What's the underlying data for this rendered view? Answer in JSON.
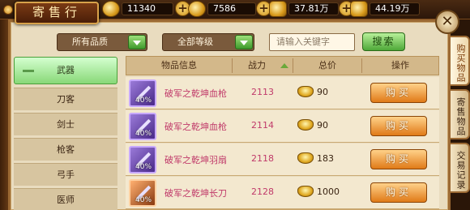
{
  "window": {
    "title": "寄售行"
  },
  "currencies": [
    {
      "icon": "gold-coin-icon",
      "value": "11340"
    },
    {
      "icon": "silver-coin-icon",
      "value": "7586"
    },
    {
      "icon": "coin-stack-icon",
      "value": "37.81万"
    },
    {
      "icon": "coin-stack-icon",
      "value": "44.19万"
    }
  ],
  "filters": {
    "quality": "所有品质",
    "level": "全部等级",
    "keyword_placeholder": "请输入关键字",
    "search_label": "搜索"
  },
  "categories": [
    {
      "label": "武器",
      "active": true
    },
    {
      "label": "刀客",
      "active": false
    },
    {
      "label": "剑士",
      "active": false
    },
    {
      "label": "枪客",
      "active": false
    },
    {
      "label": "弓手",
      "active": false
    },
    {
      "label": "医师",
      "active": false
    }
  ],
  "table": {
    "headers": {
      "item": "物品信息",
      "power": "战力",
      "price": "总价",
      "action": "操作"
    },
    "rows": [
      {
        "name": "破军之乾坤血枪",
        "power": "2113",
        "price": "90",
        "discount": "40%",
        "icon_color": "purple",
        "buy": "购买"
      },
      {
        "name": "破军之乾坤血枪",
        "power": "2114",
        "price": "90",
        "discount": "40%",
        "icon_color": "purple",
        "buy": "购买"
      },
      {
        "name": "破军之乾坤羽扇",
        "power": "2118",
        "price": "183",
        "discount": "40%",
        "icon_color": "purple",
        "buy": "购买"
      },
      {
        "name": "破军之乾坤长刀",
        "power": "2128",
        "price": "1000",
        "discount": "40%",
        "icon_color": "orange",
        "buy": "购买"
      }
    ]
  },
  "side_tabs": [
    {
      "label": "购买物品",
      "active": true
    },
    {
      "label": "寄售物品",
      "active": false
    },
    {
      "label": "交易记录",
      "active": false
    }
  ],
  "colors": {
    "accent_green": "#4ea838",
    "buy_orange": "#e07a18",
    "item_name": "#c03a6a",
    "panel_bg": "#e9dcbf"
  }
}
